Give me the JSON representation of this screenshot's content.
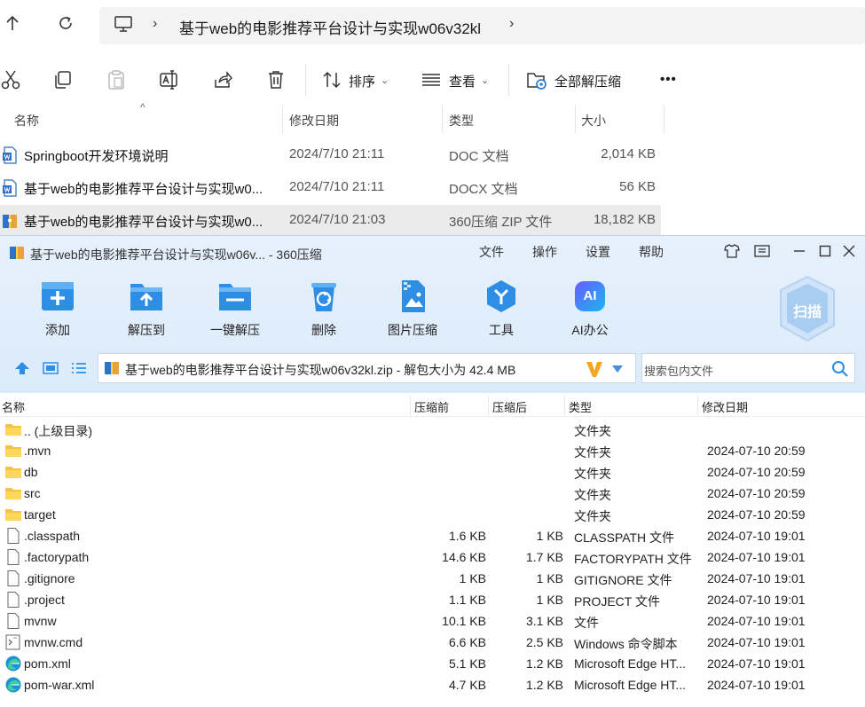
{
  "explorer": {
    "breadcrumb": "基于web的电影推荐平台设计与实现w06v32kl",
    "toolbar": {
      "sort_label": "排序",
      "view_label": "查看",
      "extract_all_label": "全部解压缩",
      "more_label": "•••"
    },
    "columns": {
      "name": "名称",
      "date": "修改日期",
      "type": "类型",
      "size": "大小"
    },
    "files": [
      {
        "name": "Springboot开发环境说明",
        "date": "2024/7/10 21:11",
        "type": "DOC 文档",
        "size": "2,014 KB",
        "icon": "word-doc-icon"
      },
      {
        "name": "基于web的电影推荐平台设计与实现w0...",
        "date": "2024/7/10 21:11",
        "type": "DOCX 文档",
        "size": "56 KB",
        "icon": "word-docx-icon"
      },
      {
        "name": "基于web的电影推荐平台设计与实现w0...",
        "date": "2024/7/10 21:03",
        "type": "360压缩 ZIP 文件",
        "size": "18,182 KB",
        "icon": "zip-archive-icon"
      }
    ]
  },
  "zip": {
    "title": "基于web的电影推荐平台设计与实现w06v... - 360压缩",
    "menu": {
      "file": "文件",
      "operate": "操作",
      "settings": "设置",
      "help": "帮助"
    },
    "actions": {
      "add": "添加",
      "extract_to": "解压到",
      "one_click": "一键解压",
      "delete": "删除",
      "image_compress": "图片压缩",
      "tools": "工具",
      "ai_office": "AI办公",
      "scan": "扫描",
      "ai_badge": "AI"
    },
    "path_text": "基于web的电影推荐平台设计与实现w06v32kl.zip - 解包大小为 42.4 MB",
    "search_placeholder": "搜索包内文件",
    "columns": {
      "name": "名称",
      "before": "压缩前",
      "after": "压缩后",
      "type": "类型",
      "date": "修改日期"
    },
    "entries": [
      {
        "name": ".. (上级目录)",
        "before": "",
        "after": "",
        "type": "文件夹",
        "date": "",
        "icon": "folder-icon"
      },
      {
        "name": ".mvn",
        "before": "",
        "after": "",
        "type": "文件夹",
        "date": "2024-07-10 20:59",
        "icon": "folder-icon"
      },
      {
        "name": "db",
        "before": "",
        "after": "",
        "type": "文件夹",
        "date": "2024-07-10 20:59",
        "icon": "folder-icon"
      },
      {
        "name": "src",
        "before": "",
        "after": "",
        "type": "文件夹",
        "date": "2024-07-10 20:59",
        "icon": "folder-icon"
      },
      {
        "name": "target",
        "before": "",
        "after": "",
        "type": "文件夹",
        "date": "2024-07-10 20:59",
        "icon": "folder-icon"
      },
      {
        "name": ".classpath",
        "before": "1.6 KB",
        "after": "1 KB",
        "type": "CLASSPATH 文件",
        "date": "2024-07-10 19:01",
        "icon": "file-icon"
      },
      {
        "name": ".factorypath",
        "before": "14.6 KB",
        "after": "1.7 KB",
        "type": "FACTORYPATH 文件",
        "date": "2024-07-10 19:01",
        "icon": "file-icon"
      },
      {
        "name": ".gitignore",
        "before": "1 KB",
        "after": "1 KB",
        "type": "GITIGNORE 文件",
        "date": "2024-07-10 19:01",
        "icon": "file-icon"
      },
      {
        "name": ".project",
        "before": "1.1 KB",
        "after": "1 KB",
        "type": "PROJECT 文件",
        "date": "2024-07-10 19:01",
        "icon": "file-icon"
      },
      {
        "name": "mvnw",
        "before": "10.1 KB",
        "after": "3.1 KB",
        "type": "文件",
        "date": "2024-07-10 19:01",
        "icon": "file-icon"
      },
      {
        "name": "mvnw.cmd",
        "before": "6.6 KB",
        "after": "2.5 KB",
        "type": "Windows 命令脚本",
        "date": "2024-07-10 19:01",
        "icon": "cmd-script-icon"
      },
      {
        "name": "pom.xml",
        "before": "5.1 KB",
        "after": "1.2 KB",
        "type": "Microsoft Edge HT...",
        "date": "2024-07-10 19:01",
        "icon": "edge-icon"
      },
      {
        "name": "pom-war.xml",
        "before": "4.7 KB",
        "after": "1.2 KB",
        "type": "Microsoft Edge HT...",
        "date": "2024-07-10 19:01",
        "icon": "edge-icon"
      }
    ]
  },
  "colors": {
    "accent_blue": "#1a86e0",
    "zip_header_bg": "#e1eefb",
    "selection_gray": "#ebebeb"
  }
}
